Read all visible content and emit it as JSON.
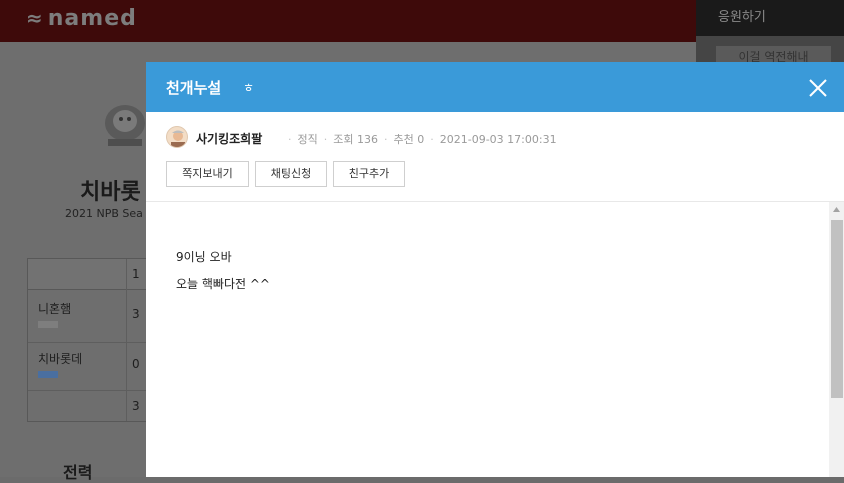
{
  "site": {
    "logo_text": "named"
  },
  "sidebar": {
    "cheer_label": "응원하기",
    "button_label": "이걸 역전해내"
  },
  "team_page": {
    "title": "치바롯",
    "season": "2021 NPB Sea",
    "scoreboard": {
      "inning_header": "1",
      "rows": [
        {
          "team": "니혼햄",
          "score": "3"
        },
        {
          "team": "치바롯데",
          "score": "0"
        },
        {
          "team": "",
          "score": "3"
        }
      ]
    },
    "section_title": "전력"
  },
  "modal": {
    "title": "천개누설",
    "title_suffix": "ㅎ",
    "author": {
      "name": "사기킹조희팔",
      "rank": "정직",
      "views": "조회 136",
      "recommend": "추천 0",
      "datetime": "2021-09-03 17:00:31"
    },
    "actions": {
      "message": "쪽지보내기",
      "chat": "채팅신청",
      "friend": "친구추가"
    },
    "content": {
      "lines": [
        "9이닝 오바",
        "오늘 핵빠다전 ^^"
      ]
    }
  },
  "colors": {
    "header_blue": "#3a9ad9"
  },
  "icons": {
    "close": "close-icon",
    "scroll_up": "arrow-up-icon",
    "avatar": "avatar"
  }
}
